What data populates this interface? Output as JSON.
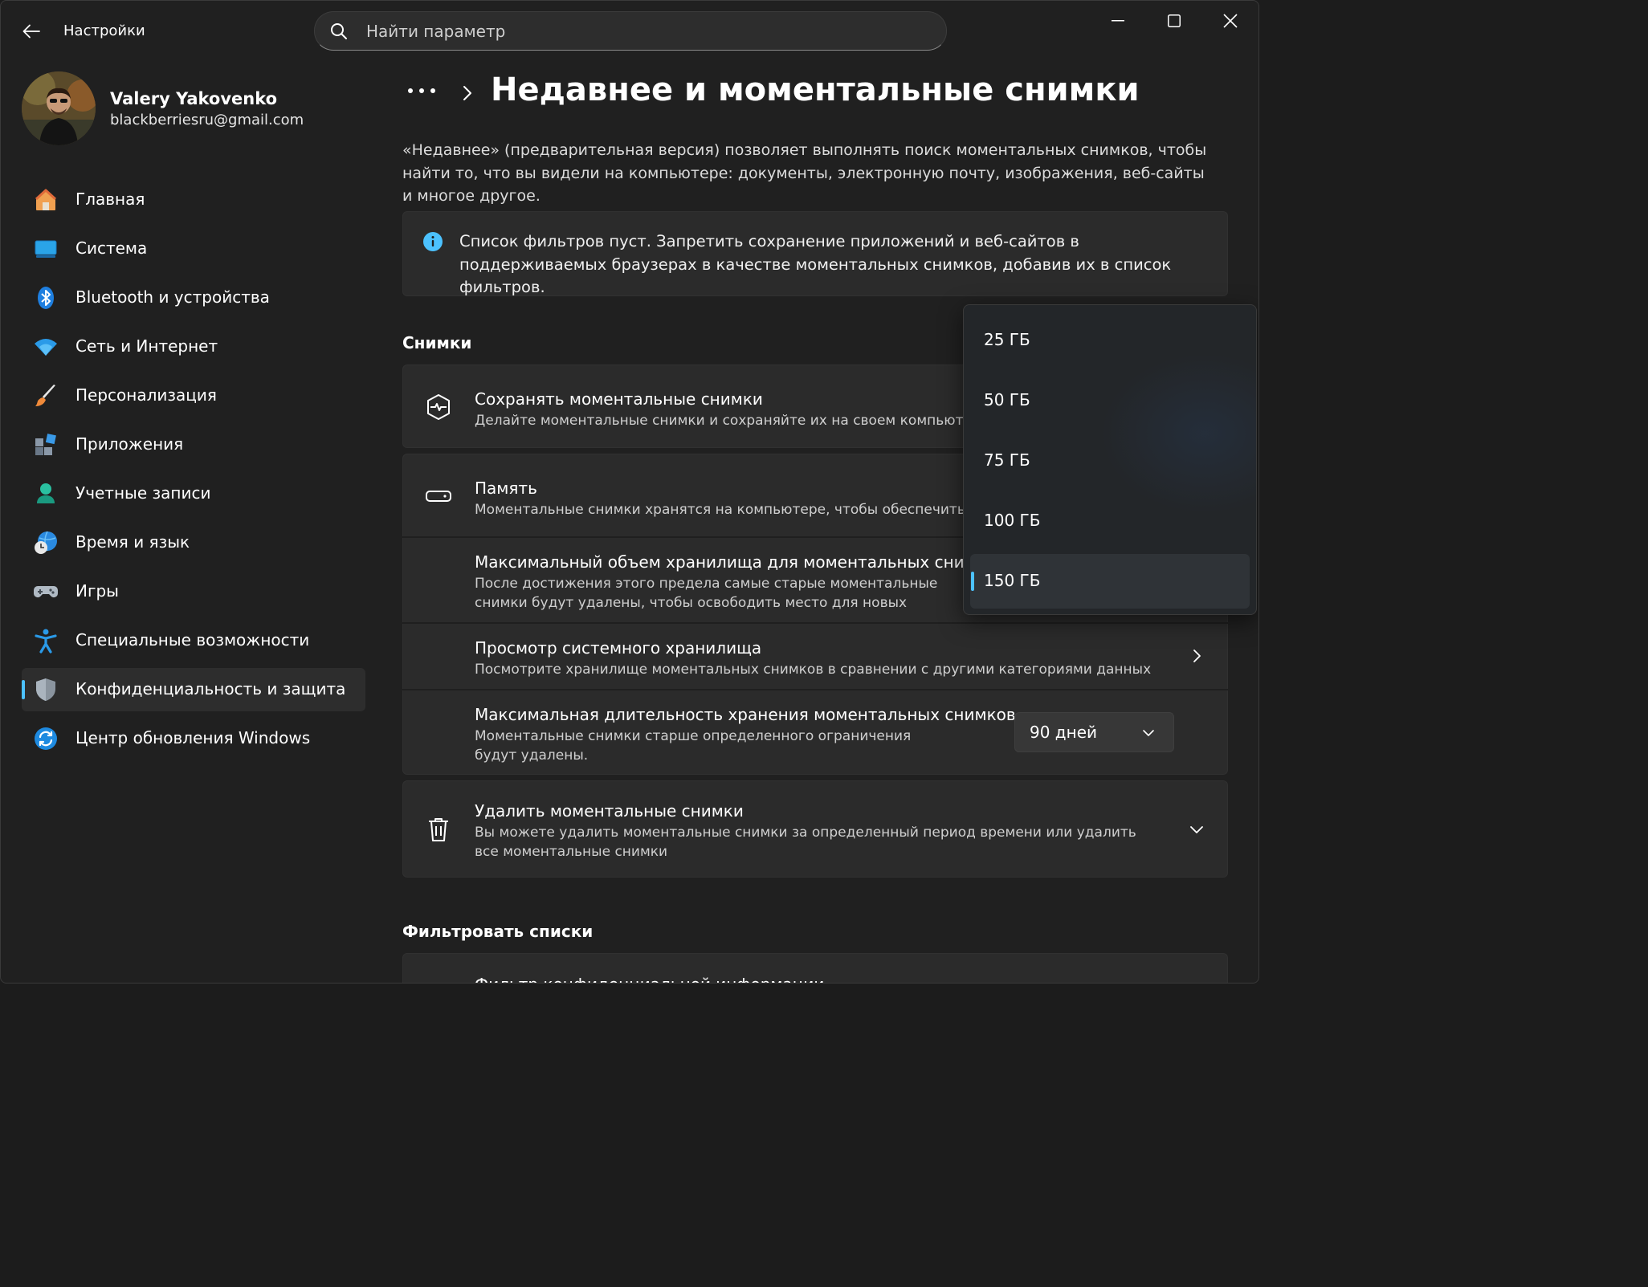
{
  "app": {
    "title": "Настройки"
  },
  "search": {
    "placeholder": "Найти параметр"
  },
  "user": {
    "name": "Valery Yakovenko",
    "email": "blackberriesru@gmail.com"
  },
  "nav": {
    "items": [
      {
        "label": "Главная",
        "icon": "home-icon"
      },
      {
        "label": "Система",
        "icon": "system-display-icon"
      },
      {
        "label": "Bluetooth и устройства",
        "icon": "bluetooth-icon"
      },
      {
        "label": "Сеть и Интернет",
        "icon": "wifi-icon"
      },
      {
        "label": "Персонализация",
        "icon": "brush-icon"
      },
      {
        "label": "Приложения",
        "icon": "apps-icon"
      },
      {
        "label": "Учетные записи",
        "icon": "account-icon"
      },
      {
        "label": "Время и язык",
        "icon": "globe-clock-icon"
      },
      {
        "label": "Игры",
        "icon": "gamepad-icon"
      },
      {
        "label": "Специальные возможности",
        "icon": "accessibility-icon"
      },
      {
        "label": "Конфиденциальность и защита",
        "icon": "shield-icon",
        "selected": true
      },
      {
        "label": "Центр обновления Windows",
        "icon": "update-icon"
      }
    ]
  },
  "page": {
    "title": "Недавнее и моментальные снимки",
    "intro": "«Недавнее» (предварительная версия) позволяет выполнять поиск моментальных снимков, чтобы найти то, что вы видели на компьютере: документы, электронную почту, изображения, веб-сайты и многое другое.",
    "info": "Список фильтров пуст. Запретить сохранение приложений и веб-сайтов в поддерживаемых браузерах в качестве моментальных снимков, добавив их в список фильтров."
  },
  "snapshots": {
    "heading": "Снимки",
    "save": {
      "title": "Сохранять моментальные снимки",
      "desc": "Делайте моментальные снимки и сохраняйте их на своем компьютере."
    },
    "memory": {
      "title": "Память",
      "desc": "Моментальные снимки хранятся на компьютере, чтобы обеспечить их б"
    },
    "max_storage": {
      "title": "Максимальный объем хранилища для моментальных снимков",
      "desc": "После достижения этого предела самые старые моментальные снимки будут удалены, чтобы освободить место для новых"
    },
    "system_storage": {
      "title": "Просмотр системного хранилища",
      "desc": "Посмотрите хранилище моментальных снимков в сравнении с другими категориями данных"
    },
    "max_duration": {
      "title": "Максимальная длительность хранения моментальных снимков",
      "desc": "Моментальные снимки старше определенного ограничения будут удалены.",
      "value": "90 дней"
    },
    "delete": {
      "title": "Удалить моментальные снимки",
      "desc": "Вы можете удалить моментальные снимки за определенный период времени или удалить все моментальные снимки"
    }
  },
  "filters": {
    "heading": "Фильтровать списки",
    "first_item": "Фильтр конфиденциальной информации"
  },
  "storage_flyout": {
    "options": [
      "25 ГБ",
      "50 ГБ",
      "75 ГБ",
      "100 ГБ",
      "150 ГБ"
    ],
    "selected": "150 ГБ"
  },
  "colors": {
    "accent": "#4cc2ff",
    "background": "#202020",
    "card": "#2b2b2b"
  }
}
